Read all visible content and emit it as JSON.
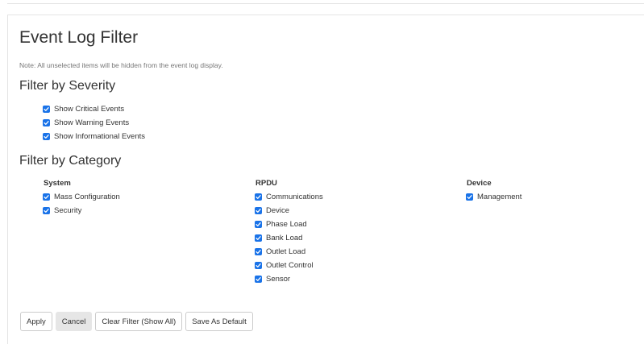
{
  "page": {
    "title": "Event Log Filter",
    "note": "Note: All unselected items will be hidden from the event log display."
  },
  "severity": {
    "heading": "Filter by Severity",
    "items": [
      {
        "label": "Show Critical Events",
        "checked": true
      },
      {
        "label": "Show Warning Events",
        "checked": true
      },
      {
        "label": "Show Informational Events",
        "checked": true
      }
    ]
  },
  "category": {
    "heading": "Filter by Category",
    "columns": [
      {
        "title": "System",
        "items": [
          {
            "label": "Mass Configuration",
            "checked": true
          },
          {
            "label": "Security",
            "checked": true
          }
        ]
      },
      {
        "title": "RPDU",
        "items": [
          {
            "label": "Communications",
            "checked": true
          },
          {
            "label": "Device",
            "checked": true
          },
          {
            "label": "Phase Load",
            "checked": true
          },
          {
            "label": "Bank Load",
            "checked": true
          },
          {
            "label": "Outlet Load",
            "checked": true
          },
          {
            "label": "Outlet Control",
            "checked": true
          },
          {
            "label": "Sensor",
            "checked": true
          }
        ]
      },
      {
        "title": "Device",
        "items": [
          {
            "label": "Management",
            "checked": true
          }
        ]
      }
    ]
  },
  "buttons": {
    "apply": "Apply",
    "cancel": "Cancel",
    "clear": "Clear Filter (Show All)",
    "save_default": "Save As Default"
  },
  "colors": {
    "checkbox": "#1a73e8",
    "text": "#333333",
    "note": "#777777"
  },
  "icons": {
    "checkbox": "checkmark-icon"
  }
}
